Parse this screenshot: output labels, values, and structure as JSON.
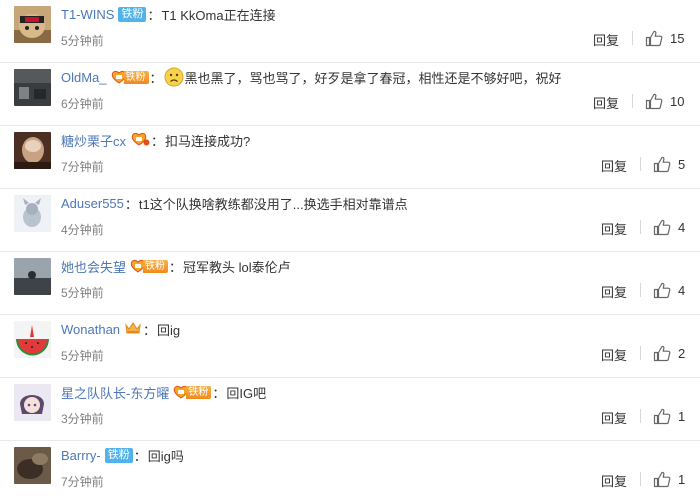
{
  "comments": [
    {
      "user": "T1-WINS",
      "badge": "铁粉",
      "text": "T1  KkOma正在连接",
      "time": "5分钟前",
      "reply": "回复",
      "likes": "15"
    },
    {
      "user": "OldMa_",
      "badge": "铁粉",
      "text": "黑也黑了，骂也骂了，好歹是拿了春冠，相性还是不够好吧，祝好",
      "emoji": "sad-face-emoji",
      "time": "6分钟前",
      "reply": "回复",
      "likes": "10"
    },
    {
      "user": "糖炒栗子cx",
      "text": "扣马连接成功?",
      "time": "7分钟前",
      "reply": "回复",
      "likes": "5"
    },
    {
      "user": "Aduser555",
      "text": "t1这个队换啥教练都没用了...换选手相对靠谱点",
      "time": "4分钟前",
      "reply": "回复",
      "likes": "4"
    },
    {
      "user": "她也会失望",
      "badge": "铁粉",
      "text": "冠军教头 lol泰伦卢",
      "time": "5分钟前",
      "reply": "回复",
      "likes": "4"
    },
    {
      "user": "Wonathan",
      "text": "回ig",
      "time": "5分钟前",
      "reply": "回复",
      "likes": "2"
    },
    {
      "user": "星之队队长-东方曜",
      "badge": "铁粉",
      "text": "回IG吧",
      "time": "3分钟前",
      "reply": "回复",
      "likes": "1"
    },
    {
      "user": "Barrry-",
      "badge": "铁粉",
      "text": "回ig吗",
      "time": "7分钟前",
      "reply": "回复",
      "likes": "1"
    }
  ],
  "colon": "：",
  "colors": {
    "username": "#4d77b7",
    "badge_blue": "#51b3ec",
    "badge_gold": "#f08a1c",
    "time": "#808080"
  }
}
